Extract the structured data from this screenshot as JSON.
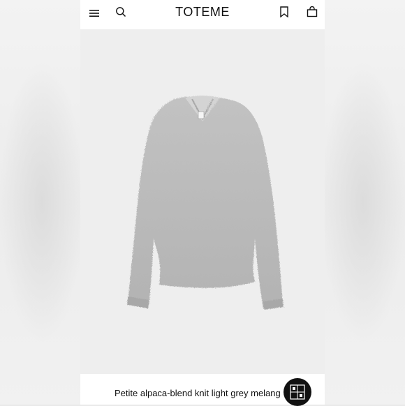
{
  "header": {
    "brand": "TOTEME",
    "menu_icon": "menu-icon",
    "search_icon": "search-icon",
    "bookmark_icon": "bookmark-icon",
    "bag_icon": "shopping-bag-icon"
  },
  "product": {
    "name": "Petite alpaca-blend knit light grey melang",
    "image": "light grey fluffy v-neck sweater"
  },
  "colors": {
    "sweater": "#b9b9b9",
    "background": "#efefef"
  }
}
